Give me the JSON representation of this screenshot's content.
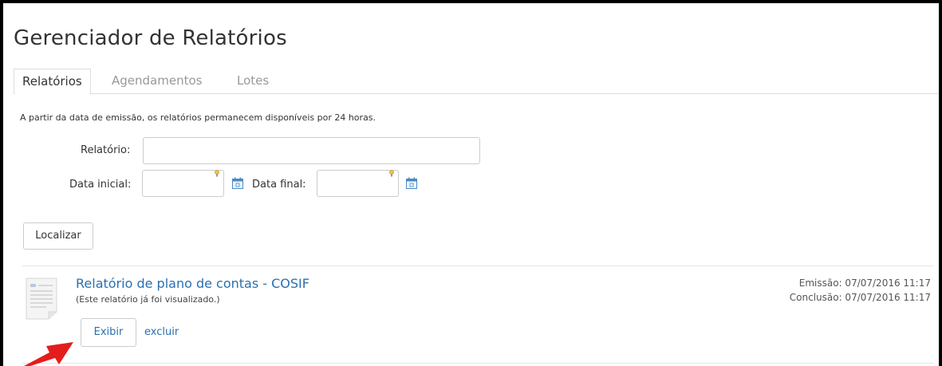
{
  "page": {
    "title": "Gerenciador de Relatórios"
  },
  "tabs": [
    {
      "label": "Relatórios",
      "active": true
    },
    {
      "label": "Agendamentos",
      "active": false
    },
    {
      "label": "Lotes",
      "active": false
    }
  ],
  "info_note": "A partir da data de emissão, os relatórios permanecem disponíveis por 24 horas.",
  "form": {
    "report_label": "Relatório:",
    "report_value": "",
    "start_label": "Data inicial:",
    "start_value": "",
    "end_label": "Data final:",
    "end_value": "",
    "search_button": "Localizar"
  },
  "results": [
    {
      "title": "Relatório de plano de contas - COSIF",
      "subtitle": "(Este relatório já foi visualizado.)",
      "emission": "Emissão: 07/07/2016 11:17",
      "conclusion": "Conclusão: 07/07/2016 11:17",
      "view_button": "Exibir",
      "delete_link": "excluir"
    }
  ],
  "icons": {
    "calendar": "calendar-icon",
    "hint": "lightbulb-icon",
    "document": "document-icon",
    "annotation": "red-arrow-annotation"
  },
  "colors": {
    "link": "#2a6fb0",
    "arrow": "#e51c1c"
  }
}
